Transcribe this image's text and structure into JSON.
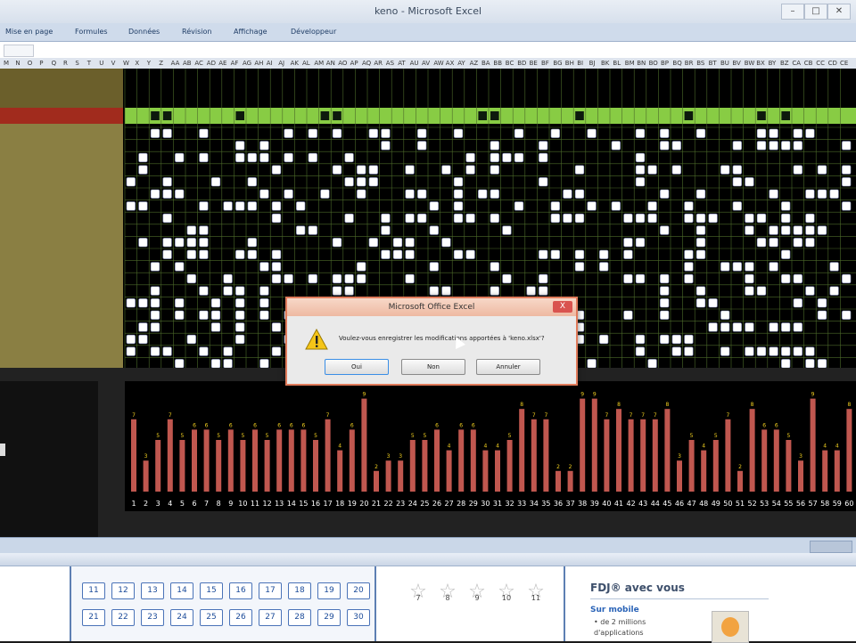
{
  "window": {
    "title": "keno - Microsoft Excel"
  },
  "menu": [
    "Mise en page",
    "Formules",
    "Données",
    "Révision",
    "Affichage",
    "Développeur"
  ],
  "column_headers": [
    "M",
    "N",
    "O",
    "P",
    "Q",
    "R",
    "S",
    "T",
    "U",
    "V",
    "W",
    "X",
    "Y",
    "Z",
    "AA",
    "AB",
    "AC",
    "AD",
    "AE",
    "AF",
    "AG",
    "AH",
    "AI",
    "AJ",
    "AK",
    "AL",
    "AM",
    "AN",
    "AO",
    "AP",
    "AQ",
    "AR",
    "AS",
    "AT",
    "AU",
    "AV",
    "AW",
    "AX",
    "AY",
    "AZ",
    "BA",
    "BB",
    "BC",
    "BD",
    "BE",
    "BF",
    "BG",
    "BH",
    "BI",
    "BJ",
    "BK",
    "BL",
    "BM",
    "BN",
    "BO",
    "BP",
    "BQ",
    "BR",
    "BS",
    "BT",
    "BU",
    "BV",
    "BW",
    "BX",
    "BY",
    "BZ",
    "CA",
    "CB",
    "CC",
    "CD",
    "CE"
  ],
  "dialog": {
    "title": "Microsoft Office Excel",
    "message": "Voulez-vous enregistrer les modifications apportées à 'keno.xlsx'?",
    "yes": "Oui",
    "no": "Non",
    "cancel": "Annuler",
    "close": "X"
  },
  "chart_data": {
    "type": "bar",
    "x": [
      1,
      2,
      3,
      4,
      5,
      6,
      7,
      8,
      9,
      10,
      11,
      12,
      13,
      14,
      15,
      16,
      17,
      18,
      19,
      20,
      21,
      22,
      23,
      24,
      25,
      26,
      27,
      28,
      29,
      30,
      31,
      32,
      33,
      34,
      35,
      36,
      37,
      38,
      39,
      40,
      41,
      42,
      43,
      44,
      45,
      46,
      47,
      48,
      49,
      50,
      51,
      52,
      53,
      54,
      55,
      56,
      57,
      58,
      59,
      60
    ],
    "values": [
      7,
      3,
      5,
      7,
      5,
      6,
      6,
      5,
      6,
      5,
      6,
      5,
      6,
      6,
      6,
      5,
      7,
      4,
      6,
      9,
      2,
      3,
      3,
      5,
      5,
      6,
      4,
      6,
      6,
      4,
      4,
      5,
      8,
      7,
      7,
      2,
      2,
      9,
      9,
      7,
      8,
      7,
      7,
      7,
      8,
      3,
      5,
      4,
      5,
      7,
      2,
      8,
      6,
      6,
      5,
      3,
      9,
      4,
      4,
      8
    ],
    "color": "#c0574f",
    "label_color": "#f2d020"
  },
  "keno_grid": {
    "marked": "#ffffff",
    "highlight": "#88cc44",
    "row_label_color": "#8f8442"
  },
  "web": {
    "numbers": [
      11,
      12,
      13,
      14,
      15,
      16,
      17,
      18,
      19,
      20,
      21,
      22,
      23,
      24,
      25,
      26,
      27,
      28,
      29,
      30
    ],
    "stars": [
      7,
      8,
      9,
      10,
      11
    ],
    "fdj_title": "FDJ® avec vous",
    "mobile_label": "Sur mobile",
    "mobile_line1": "• de 2 millions",
    "mobile_line2": "d'applications"
  }
}
